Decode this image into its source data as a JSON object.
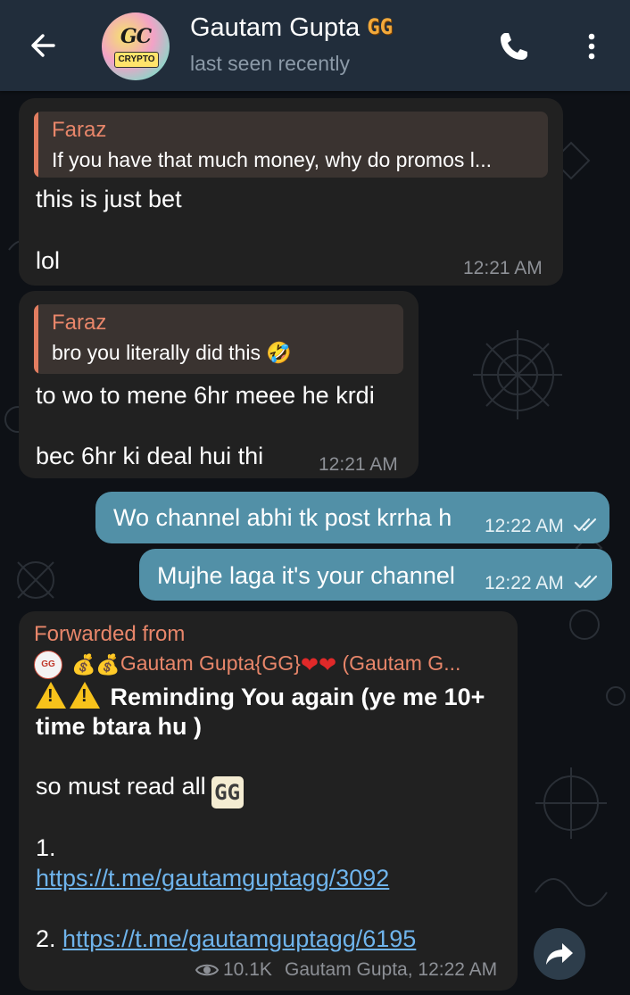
{
  "header": {
    "title": "Gautam Gupta",
    "badge": "GG",
    "status": "last seen recently",
    "avatar_top": "GC",
    "avatar_bottom": "CRYPTO"
  },
  "messages": [
    {
      "reply_name": "Faraz",
      "reply_text": "If you have that much money, why do promos l...",
      "lines": [
        "this is just bet",
        "lol"
      ],
      "time": "12:21 AM"
    },
    {
      "reply_name": "Faraz",
      "reply_text": "bro you literally did this 🤣",
      "lines": [
        "to wo to mene 6hr meee he krdi",
        "bec 6hr ki deal hui thi"
      ],
      "time": "12:21 AM"
    },
    {
      "text": "Wo channel abhi tk post krrha h",
      "time": "12:22 AM"
    },
    {
      "text": "Mujhe laga it's your channel",
      "time": "12:22 AM"
    }
  ],
  "forwarded": {
    "label": "Forwarded from",
    "mini_avatar": "GG",
    "from_name": "Gautam Gupta{GG}",
    "from_suffix": "(Gautam G...",
    "heading_1": "Reminding You again (ye me 10+",
    "heading_2": "time btara hu )",
    "line_read": "so must read all",
    "read_emoji": "GG",
    "item1_num": "1.",
    "item1_link": "https://t.me/gautamguptagg/3092",
    "item2_num": "2.",
    "item2_link": "https://t.me/gautamguptagg/6195",
    "views": "10.1K",
    "footer": "Gautam Gupta, 12:22 AM"
  },
  "colors": {
    "header_bg": "#212d3b",
    "incoming_bubble": "#212121",
    "outgoing_bubble": "#5290a7",
    "reply_name": "#e8866a",
    "link": "#6fb4ec"
  },
  "icons": [
    "arrow-back-icon",
    "phone-icon",
    "more-vertical-icon",
    "double-check-icon",
    "eye-icon",
    "share-icon",
    "warning-icon",
    "money-bag-icon",
    "heart-icon"
  ]
}
